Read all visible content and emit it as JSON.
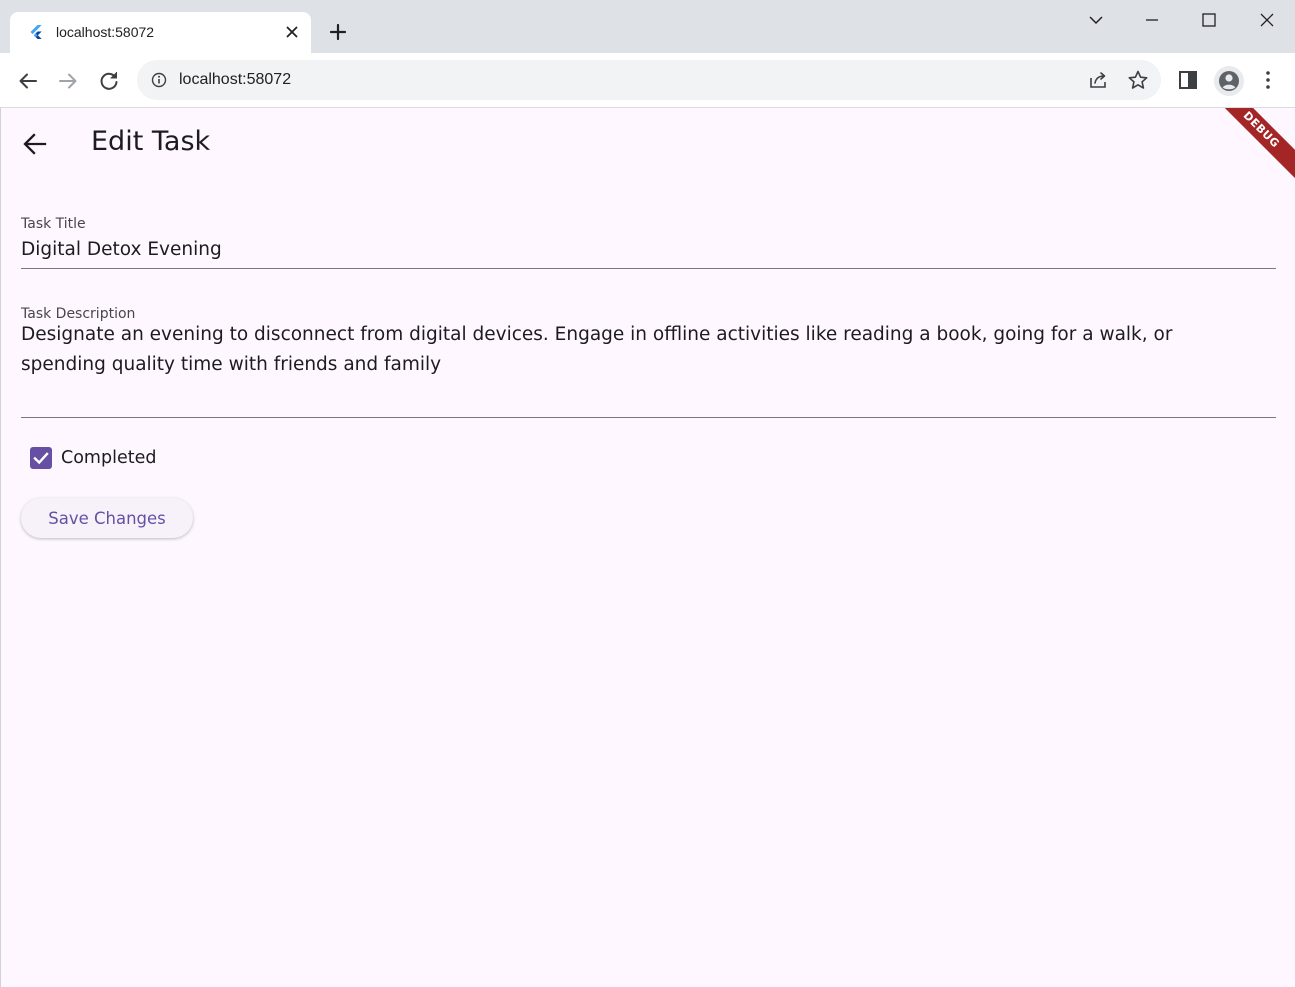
{
  "browser": {
    "tab_title": "localhost:58072",
    "url": "localhost:58072"
  },
  "app": {
    "title": "Edit Task",
    "debug_banner": "DEBUG",
    "accent_color": "#6750a4",
    "background_color": "#fef7ff",
    "form": {
      "title_label": "Task Title",
      "title_value": "Digital Detox Evening",
      "description_label": "Task Description",
      "description_value": "Designate an evening to disconnect from digital devices. Engage in offline activities like reading a book, going for a walk, or spending quality time with friends and family",
      "completed_label": "Completed",
      "completed_checked": true,
      "save_label": "Save Changes"
    }
  }
}
